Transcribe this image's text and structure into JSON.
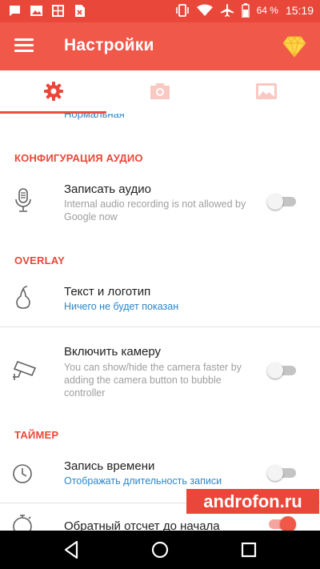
{
  "status_bar": {
    "battery": "64 %",
    "time": "15:19",
    "left_icons": [
      "sms-icon",
      "gallery-icon",
      "gallery-alt-icon",
      "file-icon"
    ],
    "right_icons": [
      "vibrate-icon",
      "wifi-icon",
      "airplane-icon",
      "battery-icon"
    ]
  },
  "app_bar": {
    "title": "Настройки",
    "menu_icon": "hamburger-icon",
    "action_icon": "diamond-icon"
  },
  "tabs": [
    {
      "icon": "gear-icon",
      "active": true
    },
    {
      "icon": "camera-icon",
      "active": false
    },
    {
      "icon": "image-icon",
      "active": false
    }
  ],
  "content": {
    "partial_value": "Нормальная",
    "sections": [
      {
        "header": "КОНФИГУРАЦИЯ АУДИО",
        "items": [
          {
            "icon": "microphone-icon",
            "title": "Записать аудио",
            "subtitle": "Internal audio recording is not allowed by Google now",
            "toggle": false
          }
        ]
      },
      {
        "header": "OVERLAY",
        "items": [
          {
            "icon": "pear-icon",
            "title": "Текст и логотип",
            "subtitle": "Ничего не будет показан"
          },
          {
            "icon": "security-camera-icon",
            "title": "Включить камеру",
            "subtitle": "You can show/hide the camera faster by adding the camera button to bubble controller",
            "toggle": false
          }
        ]
      },
      {
        "header": "ТАЙМЕР",
        "items": [
          {
            "icon": "clock-icon",
            "title": "Запись времени",
            "subtitle": "Отображать длительность записи",
            "toggle": false
          },
          {
            "icon": "stopwatch-icon",
            "title": "Обратный отсчет до начала",
            "toggle": true
          }
        ]
      }
    ]
  },
  "watermark": "androfon.ru",
  "nav_bar": {
    "icons": [
      "back-icon",
      "home-icon",
      "recents-icon"
    ]
  },
  "colors": {
    "primary": "#f0584a",
    "status_bar": "#e8473a",
    "accent_text": "#e8473a",
    "link": "#2b86c9",
    "gem": "#ffd54a"
  }
}
